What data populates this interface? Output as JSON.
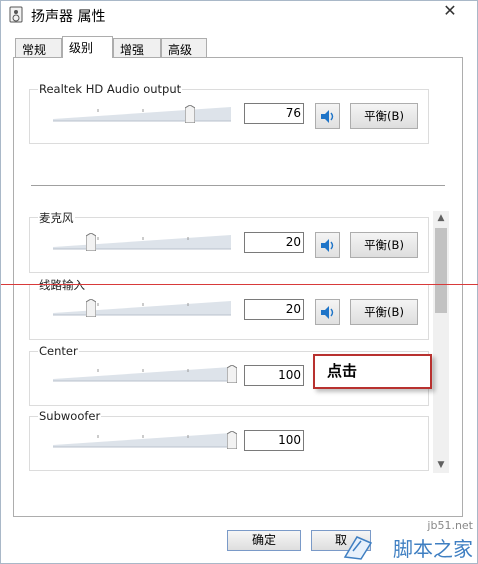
{
  "window": {
    "title": "扬声器 属性",
    "close_symbol": "✕"
  },
  "tabs": [
    {
      "label": "常规",
      "active": false
    },
    {
      "label": "级别",
      "active": true
    },
    {
      "label": "增强",
      "active": false
    },
    {
      "label": "高级",
      "active": false
    }
  ],
  "master": {
    "label": "Realtek HD Audio output",
    "value": "76",
    "level": 76,
    "balance_label": "平衡(B)"
  },
  "channels": [
    {
      "label": "麦克风",
      "value": "20",
      "level": 20,
      "balance_label": "平衡(B)"
    },
    {
      "label": "线路输入",
      "value": "20",
      "level": 20,
      "balance_label": "平衡(B)"
    },
    {
      "label": "Center",
      "value": "100",
      "level": 100
    },
    {
      "label": "Subwoofer",
      "value": "100",
      "level": 100
    }
  ],
  "callout": {
    "text": "点击"
  },
  "footer": {
    "ok_label": "确定",
    "cancel_label": "取"
  },
  "watermark": {
    "url": "jb51.net",
    "name": "脚本之家"
  },
  "colors": {
    "accent_blue": "#1e74c8",
    "callout_border": "#b8312f",
    "marker_line": "#d83a3a",
    "watermark_blue": "#3f7fc2"
  },
  "icons": {
    "speaker": "speaker-icon",
    "app": "speaker-device-icon"
  }
}
